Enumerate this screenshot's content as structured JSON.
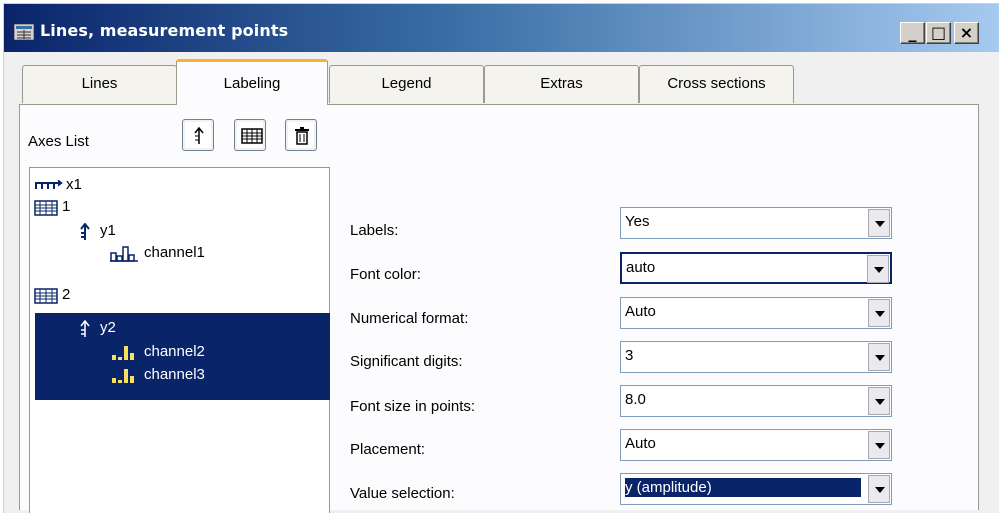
{
  "window": {
    "title": "Lines, measurement points",
    "buttons": [
      "_",
      "□",
      "×"
    ]
  },
  "tabs": [
    {
      "label": "Lines",
      "active": false
    },
    {
      "label": "Labeling",
      "active": true
    },
    {
      "label": "Legend",
      "active": false
    },
    {
      "label": "Extras",
      "active": false
    },
    {
      "label": "Cross sections",
      "active": false
    }
  ],
  "axes_list": {
    "label": "Axes List",
    "toolbar_icons": [
      "axis-up-icon",
      "grid-icon",
      "trash-icon"
    ],
    "tree": [
      {
        "label": "x1",
        "icon": "x-axis-icon",
        "selected": false
      },
      {
        "label": "1",
        "icon": "grid-icon",
        "selected": false
      },
      {
        "label": "y1",
        "icon": "y-axis-icon",
        "selected": false
      },
      {
        "label": "channel1",
        "icon": "bar-chart-icon",
        "selected": false
      },
      {
        "label": "2",
        "icon": "grid-icon",
        "selected": false
      },
      {
        "label": "y2",
        "icon": "y-axis-icon",
        "selected": true
      },
      {
        "label": "channel2",
        "icon": "bar-chart-icon",
        "selected": true
      },
      {
        "label": "channel3",
        "icon": "bar-chart-icon",
        "selected": true
      }
    ]
  },
  "fields": [
    {
      "label": "Labels:",
      "value": "Yes"
    },
    {
      "label": "Font color:",
      "value": "auto"
    },
    {
      "label": "Numerical format:",
      "value": "Auto"
    },
    {
      "label": "Significant digits:",
      "value": "3"
    },
    {
      "label": "Font size in points:",
      "value": "8.0"
    },
    {
      "label": "Placement:",
      "value": "Auto"
    },
    {
      "label": "Value selection:",
      "value": "y (amplitude)"
    }
  ],
  "colors": {
    "title_gradient_start": "#0a246a",
    "selection": "#0a246a",
    "active_tab_accent": "#f8b332"
  }
}
